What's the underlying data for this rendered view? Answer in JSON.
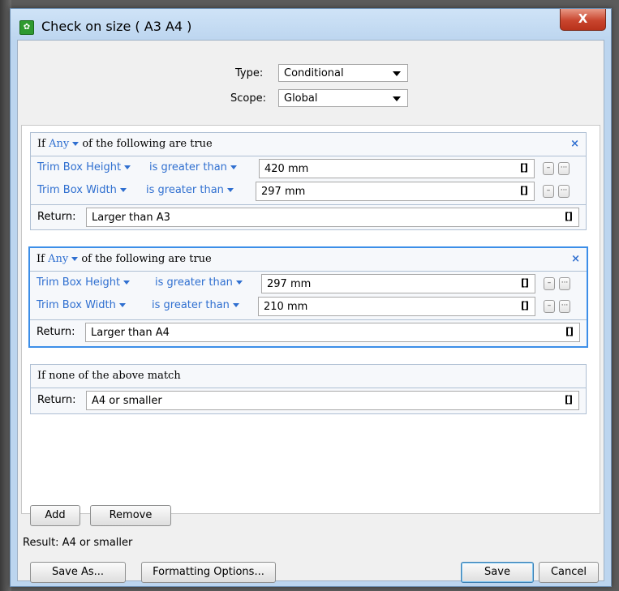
{
  "window": {
    "title": "Check on size ( A3 A4 )",
    "close_glyph": "X"
  },
  "type_field": {
    "label": "Type:",
    "value": "Conditional"
  },
  "scope_field": {
    "label": "Scope:",
    "value": "Global"
  },
  "rules": [
    {
      "header_prefix": "If",
      "quantifier": "Any",
      "header_suffix": "of the following are true",
      "remove_glyph": "×",
      "conditions": [
        {
          "property": "Trim Box Height",
          "operator": "is greater than",
          "value": "420 mm"
        },
        {
          "property": "Trim Box Width",
          "operator": "is greater than",
          "value": "297 mm"
        }
      ],
      "return_label": "Return:",
      "return_value": "Larger than A3"
    },
    {
      "header_prefix": "If",
      "quantifier": "Any",
      "header_suffix": "of the following are true",
      "remove_glyph": "×",
      "conditions": [
        {
          "property": "Trim Box Height",
          "operator": "is greater than",
          "value": "297 mm"
        },
        {
          "property": "Trim Box Width",
          "operator": "is greater than",
          "value": "210 mm"
        }
      ],
      "return_label": "Return:",
      "return_value": "Larger than A4"
    }
  ],
  "fallback": {
    "header": "If none of the above match",
    "return_label": "Return:",
    "return_value": "A4 or smaller"
  },
  "bracket_glyph": "[]",
  "minus_glyph": "–",
  "more_glyph": "···",
  "buttons": {
    "add": "Add",
    "remove": "Remove",
    "save_as": "Save As...",
    "formatting": "Formatting Options...",
    "save": "Save",
    "cancel": "Cancel"
  },
  "result_text": "Result: A4 or smaller",
  "colors": {
    "accent_blue": "#2f6fd0",
    "selection_border": "#3c8ee8",
    "close_red": "#c9452e"
  }
}
